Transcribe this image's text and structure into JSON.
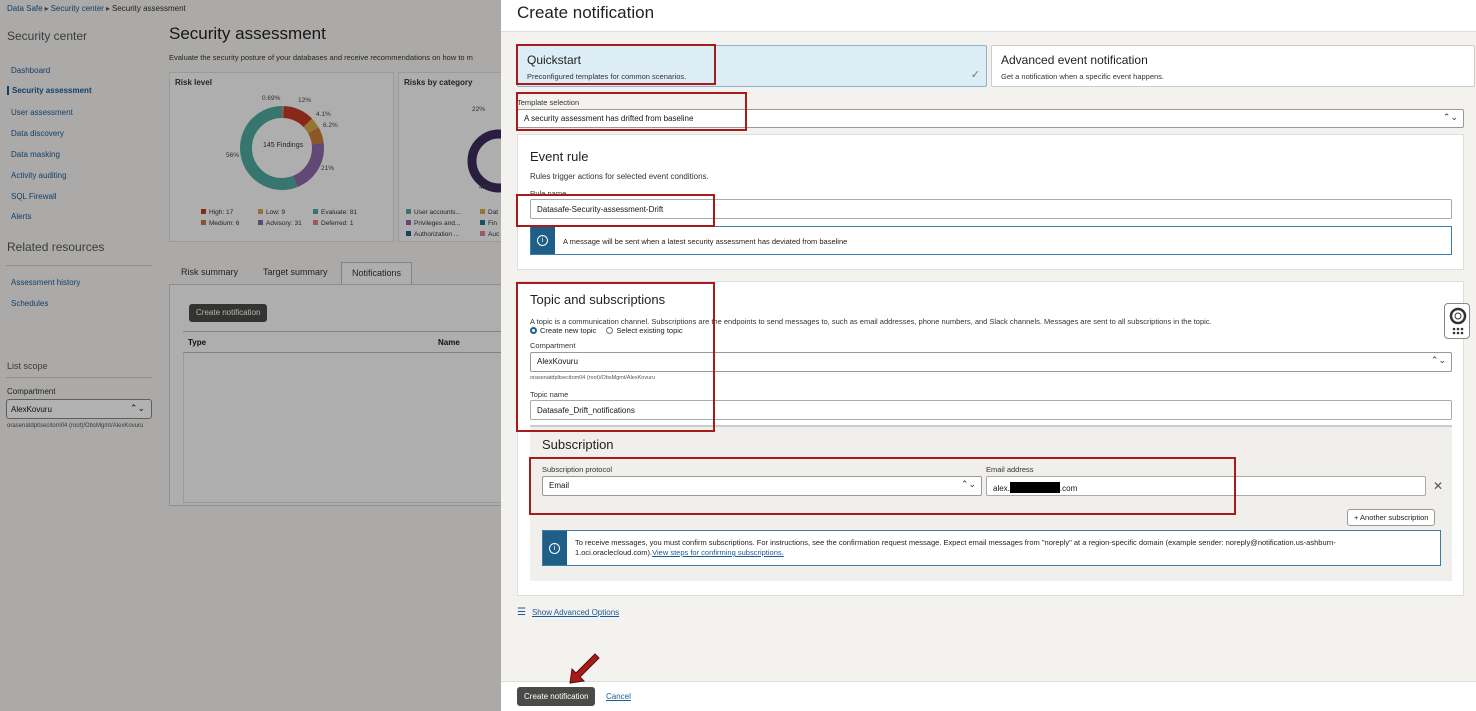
{
  "background": {
    "breadcrumb": [
      "Data Safe",
      "Security center",
      "Security assessment"
    ],
    "left_nav": {
      "heading": "Security center",
      "items": [
        "Dashboard",
        "Security assessment",
        "User assessment",
        "Data discovery",
        "Data masking",
        "Activity auditing",
        "SQL Firewall",
        "Alerts"
      ],
      "related_heading": "Related resources",
      "related_items": [
        "Assessment history",
        "Schedules"
      ],
      "list_scope_heading": "List scope",
      "compartment_label": "Compartment",
      "compartment_value": "AlexKovuru",
      "compartment_path": "orasenatdpltsecitom04 (root)/ObsMgmt/AlexKovuru"
    },
    "main": {
      "title": "Security assessment",
      "description": "Evaluate the security posture of your databases and receive recommendations on how to m",
      "risk_level": {
        "title": "Risk level",
        "center_label": "145 Findings",
        "slices": [
          {
            "label": "0.69%",
            "color": "#d9838f"
          },
          {
            "label": "12%",
            "color": "#c23a26"
          },
          {
            "label": "4.1%",
            "color": "#d4a94a"
          },
          {
            "label": "6.2%",
            "color": "#c77a3a"
          },
          {
            "label": "21%",
            "color": "#8a6aa8"
          },
          {
            "label": "56%",
            "color": "#4fa9a0"
          }
        ],
        "legend": [
          {
            "text": "High: 17",
            "color": "#c23a26"
          },
          {
            "text": "Low: 9",
            "color": "#d4a94a"
          },
          {
            "text": "Evaluate: 81",
            "color": "#4fa9a0"
          },
          {
            "text": "Medium: 6",
            "color": "#c77a3a"
          },
          {
            "text": "Advisory: 31",
            "color": "#8a6aa8"
          },
          {
            "text": "Deferred: 1",
            "color": "#d9838f"
          }
        ]
      },
      "risks_by_category": {
        "title": "Risks by category",
        "labels": [
          "22%",
          "41%"
        ],
        "legend": [
          {
            "text": "User accounts...",
            "color": "#4fa9a0"
          },
          {
            "text": "Dat",
            "color": "#d4a94a"
          },
          {
            "text": "Privileges and...",
            "color": "#8a6aa8"
          },
          {
            "text": "Fin",
            "color": "#2f6f8f"
          },
          {
            "text": "Authorization ...",
            "color": "#1f5f87"
          },
          {
            "text": "Auc",
            "color": "#d9838f"
          }
        ]
      },
      "tabs": [
        "Risk summary",
        "Target summary",
        "Notifications"
      ],
      "create_button": "Create notification",
      "table_headers": [
        "Type",
        "Name"
      ]
    }
  },
  "drawer": {
    "title": "Create notification",
    "modes": [
      {
        "title": "Quickstart",
        "desc": "Preconfigured templates for common scenarios.",
        "selected": true
      },
      {
        "title": "Advanced event notification",
        "desc": "Get a notification when a specific event happens.",
        "selected": false
      }
    ],
    "template_label": "Template selection",
    "template_value": "A security assessment has drifted from baseline",
    "event_rule": {
      "title": "Event rule",
      "desc": "Rules trigger actions for selected event conditions.",
      "rule_name_label": "Rule name",
      "rule_name_value": "Datasafe-Security-assessment-Drift",
      "info": "A message will be sent when a latest security assessment has deviated from baseline"
    },
    "topic": {
      "title": "Topic and subscriptions",
      "desc": "A topic is a communication channel. Subscriptions are the endpoints to send messages to, such as email addresses, phone numbers, and Slack channels. Messages are sent to all subscriptions in the topic.",
      "radio_create": "Create new topic",
      "radio_existing": "Select existing topic",
      "compartment_label": "Compartment",
      "compartment_value": "AlexKovuru",
      "compartment_path": "orasenatdpltsecitom04 (root)/ObsMgmt/AlexKovuru",
      "topic_name_label": "Topic name",
      "topic_name_value": "Datasafe_Drift_notifications"
    },
    "subscription": {
      "title": "Subscription",
      "protocol_label": "Subscription protocol",
      "protocol_value": "Email",
      "email_label": "Email address",
      "email_prefix": "alex.",
      "email_suffix": ".com",
      "another_button": "+ Another subscription",
      "info_text": "To receive messages, you must confirm subscriptions. For instructions, see the confirmation request message. Expect email messages from \"noreply\" at a region-specific domain (example sender: noreply@notification.us-ashburn-1.oci.oraclecloud.com).",
      "info_link": "View steps for confirming subscriptions."
    },
    "advanced_options": "Show Advanced Options",
    "footer": {
      "create_button": "Create notification",
      "cancel": "Cancel"
    }
  },
  "colors": {
    "accent": "#1f5f87",
    "highlight_box": "#a61b1b",
    "primary_button": "#4a4a48"
  }
}
